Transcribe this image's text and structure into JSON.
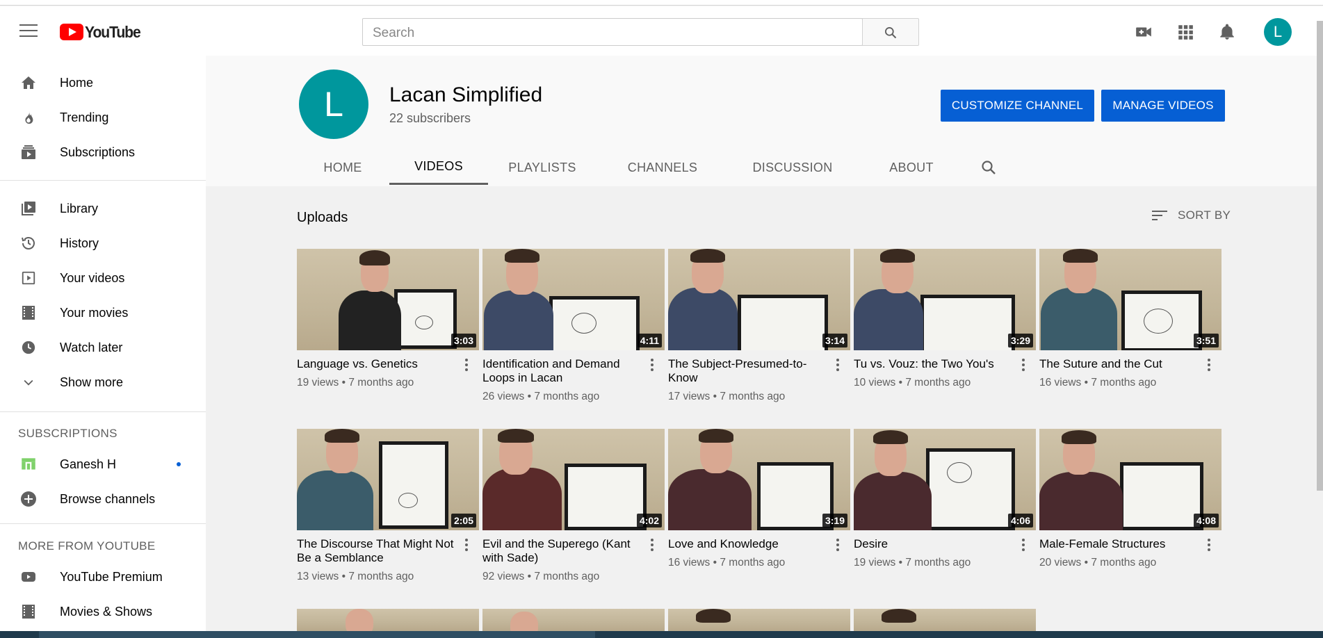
{
  "header": {
    "logo_text": "YouTube",
    "search_placeholder": "Search",
    "user_initial": "L"
  },
  "sidebar": {
    "main": [
      {
        "label": "Home",
        "icon": "home-icon"
      },
      {
        "label": "Trending",
        "icon": "trending-icon"
      },
      {
        "label": "Subscriptions",
        "icon": "subscriptions-icon"
      }
    ],
    "library": [
      {
        "label": "Library",
        "icon": "library-icon"
      },
      {
        "label": "History",
        "icon": "history-icon"
      },
      {
        "label": "Your videos",
        "icon": "your-videos-icon"
      },
      {
        "label": "Your movies",
        "icon": "movies-icon"
      },
      {
        "label": "Watch later",
        "icon": "clock-icon"
      },
      {
        "label": "Show more",
        "icon": "chevron-down-icon"
      }
    ],
    "subscriptions_heading": "SUBSCRIPTIONS",
    "subscriptions": [
      {
        "label": "Ganesh H",
        "icon": "channel-avatar-icon"
      },
      {
        "label": "Browse channels",
        "icon": "add-circle-icon"
      }
    ],
    "more_heading": "MORE FROM YOUTUBE",
    "more": [
      {
        "label": "YouTube Premium",
        "icon": "youtube-icon"
      },
      {
        "label": "Movies & Shows",
        "icon": "movies-icon"
      }
    ]
  },
  "channel": {
    "initial": "L",
    "name": "Lacan Simplified",
    "subscribers": "22 subscribers",
    "customize_label": "CUSTOMIZE CHANNEL",
    "manage_label": "MANAGE VIDEOS",
    "tabs": [
      "HOME",
      "VIDEOS",
      "PLAYLISTS",
      "CHANNELS",
      "DISCUSSION",
      "ABOUT"
    ],
    "active_tab": "VIDEOS"
  },
  "uploads": {
    "title": "Uploads",
    "sort_label": "SORT BY",
    "videos": [
      {
        "title": "Language vs. Genetics",
        "duration": "3:03",
        "views": "19 views",
        "age": "7 months ago"
      },
      {
        "title": "Identification and Demand Loops in Lacan",
        "duration": "4:11",
        "views": "26 views",
        "age": "7 months ago"
      },
      {
        "title": "The Subject-Presumed-to-Know",
        "duration": "3:14",
        "views": "17 views",
        "age": "7 months ago"
      },
      {
        "title": "Tu vs. Vouz: the Two You's",
        "duration": "3:29",
        "views": "10 views",
        "age": "7 months ago"
      },
      {
        "title": "The Suture and the Cut",
        "duration": "3:51",
        "views": "16 views",
        "age": "7 months ago"
      },
      {
        "title": "The Discourse That Might Not Be a Semblance",
        "duration": "2:05",
        "views": "13 views",
        "age": "7 months ago"
      },
      {
        "title": "Evil and the Superego (Kant with Sade)",
        "duration": "4:02",
        "views": "92 views",
        "age": "7 months ago"
      },
      {
        "title": "Love and Knowledge",
        "duration": "3:19",
        "views": "16 views",
        "age": "7 months ago"
      },
      {
        "title": "Desire",
        "duration": "4:06",
        "views": "19 views",
        "age": "7 months ago"
      },
      {
        "title": "Male-Female Structures",
        "duration": "4:08",
        "views": "20 views",
        "age": "7 months ago"
      }
    ]
  },
  "colors": {
    "brand_red": "#ff0000",
    "button_blue": "#065fd4",
    "avatar_teal": "#00979d"
  }
}
